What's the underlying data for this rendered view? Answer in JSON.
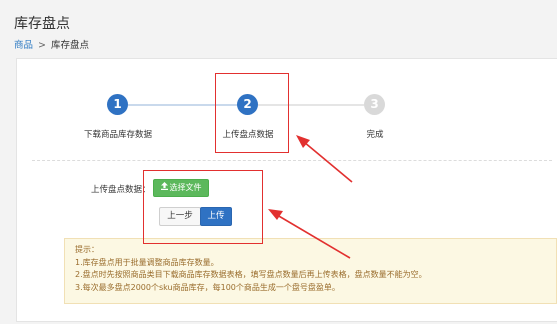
{
  "page": {
    "title": "库存盘点",
    "breadcrumb": {
      "parent": "商品",
      "separator": ">",
      "current": "库存盘点"
    }
  },
  "steps": [
    {
      "number": "1",
      "label": "下载商品库存数据",
      "state": "done"
    },
    {
      "number": "2",
      "label": "上传盘点数据",
      "state": "current"
    },
    {
      "number": "3",
      "label": "完成",
      "state": "todo"
    }
  ],
  "form": {
    "upload_label": "上传盘点数据：",
    "choose_file_label": "选择文件",
    "choose_file_icon": "upload-icon",
    "prev_label": "上一步",
    "upload_label_btn": "上传"
  },
  "tips": {
    "title": "提示：",
    "lines": [
      "1.库存盘点用于批量调整商品库存数量。",
      "2.盘点时先按照商品类目下载商品库存数据表格，填写盘点数量后再上传表格，盘点数量不能为空。",
      "3.每次最多盘点2000个sku商品库存，每100个商品生成一个盘号盘盈单。"
    ]
  },
  "colors": {
    "primary": "#2f72c3",
    "success": "#5cb85c",
    "annotation": "#e2302f",
    "tips_bg": "#fcf8e3",
    "tips_text": "#9a6d2d"
  }
}
